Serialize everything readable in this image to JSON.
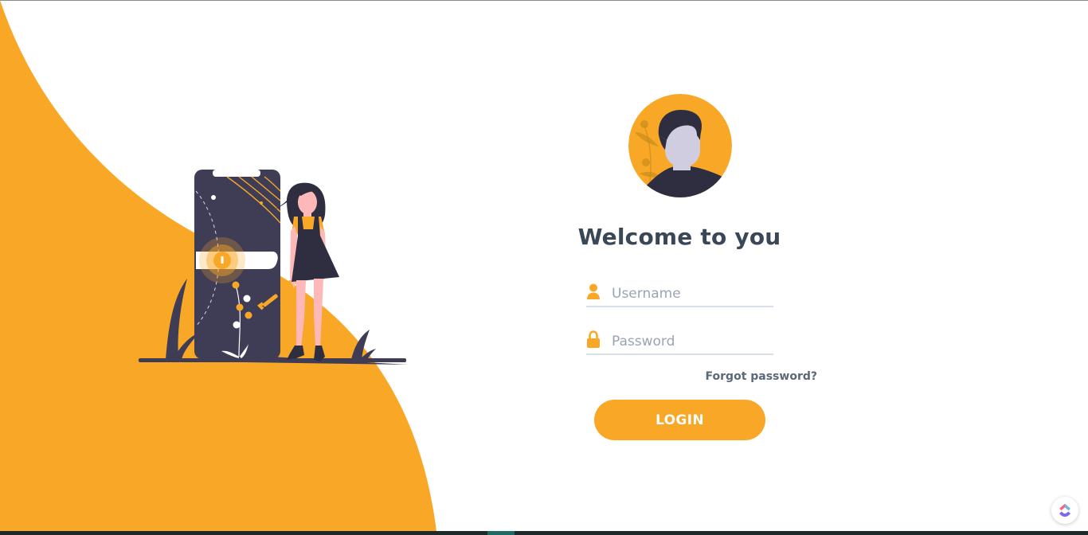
{
  "login": {
    "title": "Welcome to you",
    "username_placeholder": "Username",
    "password_placeholder": "Password",
    "forgot_password": "Forgot password?",
    "login_button": "LOGIN"
  },
  "icons": {
    "username": "user-icon",
    "password": "lock-icon",
    "avatar": "avatar-icon",
    "widget": "clickup-icon"
  },
  "colors": {
    "accent": "#f8a826",
    "title": "#3a4757",
    "dark": "#3f3d56"
  }
}
